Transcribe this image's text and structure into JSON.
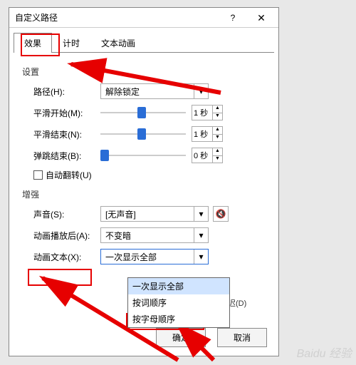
{
  "dialog": {
    "title": "自定义路径",
    "help": "?",
    "close": "✕"
  },
  "tabs": {
    "t1": "效果",
    "t2": "计时",
    "t3": "文本动画"
  },
  "section": {
    "settings": "设置",
    "enhance": "增强"
  },
  "settings": {
    "path_label": "路径(H):",
    "path_value": "解除锁定",
    "smooth_start_label": "平滑开始(M):",
    "smooth_start_value": "1 秒",
    "smooth_end_label": "平滑结束(N):",
    "smooth_end_value": "1 秒",
    "bounce_label": "弹跳结束(B):",
    "bounce_value": "0 秒",
    "autoflip_label": "自动翻转(U)"
  },
  "enhance": {
    "sound_label": "声音(S):",
    "sound_value": "[无声音]",
    "after_label": "动画播放后(A):",
    "after_value": "不变暗",
    "text_label": "动画文本(X):",
    "text_value": "一次显示全部",
    "text_options": [
      "一次显示全部",
      "按词顺序",
      "按字母顺序"
    ],
    "delay_hint": "之间延迟(D)"
  },
  "buttons": {
    "ok": "确定",
    "cancel": "取消"
  },
  "watermark": "Baidu 经验"
}
